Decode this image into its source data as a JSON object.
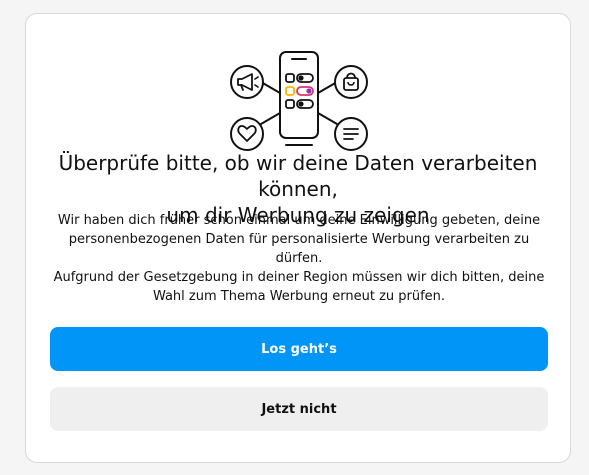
{
  "dialog": {
    "title_line1": "Überprüfe bitte, ob wir deine Daten verarbeiten können,",
    "title_line2": "um dir Werbung zu zeigen",
    "body_lines": [
      "Wir haben dich früher schon einmal um deine Einwilligung gebeten, deine",
      "personenbezogenen Daten für personalisierte Werbung verarbeiten zu dürfen.",
      "Aufgrund der Gesetzgebung in deiner Region müssen wir dich bitten, deine",
      "Wahl zum Thema Werbung erneut zu prüfen."
    ],
    "primary_button": "Los geht’s",
    "secondary_button": "Jetzt nicht"
  },
  "illustration": {
    "icons": [
      "megaphone-icon",
      "shopping-bag-icon",
      "heart-icon",
      "text-lines-icon",
      "phone-icon"
    ],
    "accent_colors": [
      "#f5c518",
      "#e1306c",
      "#8a3ab9"
    ]
  },
  "colors": {
    "primary": "#0095f6",
    "secondary_bg": "#efefef",
    "text": "#111111"
  }
}
